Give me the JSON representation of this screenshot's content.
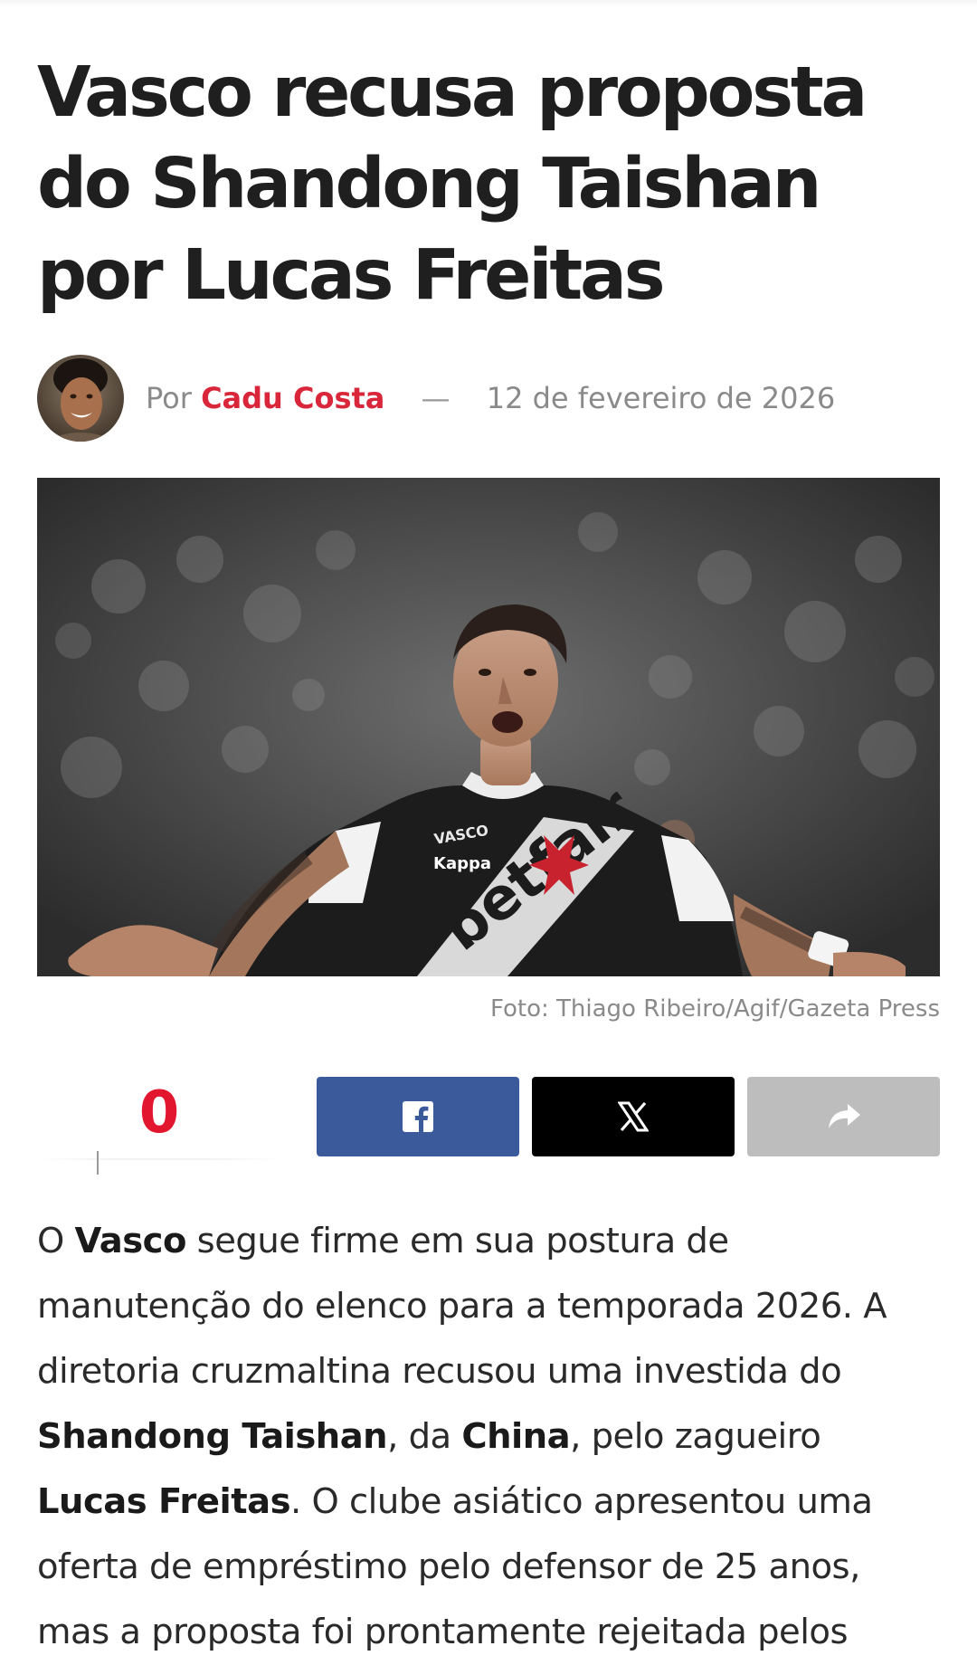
{
  "article": {
    "title": "Vasco recusa proposta do Shandong Taishan por Lucas Freitas",
    "byline": {
      "prefix": "Por",
      "author": "Cadu Costa",
      "separator": "—",
      "date": "12 de fevereiro de 2026"
    },
    "hero_image": {
      "jersey_sponsor": "betfair",
      "kit_brand": "Kappa",
      "crest_text": "VASCO"
    },
    "caption": "Foto: Thiago Ribeiro/Agif/Gazeta Press",
    "share": {
      "count": "0",
      "facebook_icon": "facebook-icon",
      "x_icon": "x-icon",
      "share_icon": "share-arrow-icon"
    },
    "body": {
      "p1_s1": "O ",
      "p1_b1": "Vasco",
      "p1_s2": " segue firme em sua postura de manutenção do elenco para a temporada 2026. A diretoria cruzmaltina recusou uma investida do ",
      "p1_b2": "Shandong Taishan",
      "p1_s3": ", da ",
      "p1_b3": "China",
      "p1_s4": ", pelo zagueiro ",
      "p1_b4": "Lucas Freitas",
      "p1_s5": ". O clube asiático apresentou uma oferta de empréstimo pelo defensor de 25 anos, mas a proposta foi prontamente rejeitada pelos"
    }
  },
  "colors": {
    "author": "#d9263a",
    "share_count": "#e3162f",
    "facebook": "#3b5a9c",
    "x": "#000000",
    "share": "#bdbdbd"
  }
}
